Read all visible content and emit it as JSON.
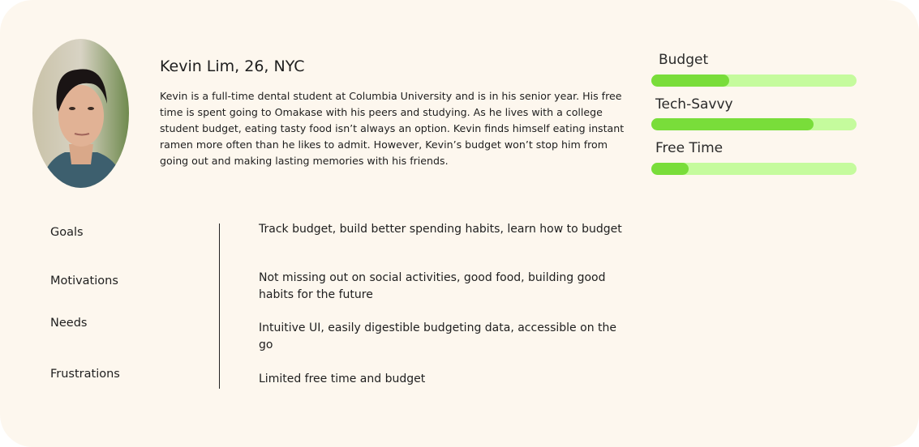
{
  "persona": {
    "name": "Kevin Lim, 26, NYC",
    "bio": "Kevin is a full-time dental student at Columbia University and is in his senior year. His free time is spent going to Omakase with his peers and studying. As he lives with a college student budget, eating tasty food isn’t always an option. Kevin finds himself eating instant ramen more often than he likes to admit. However, Kevin’s budget won’t stop him from going out and making lasting memories with his friends."
  },
  "meters": [
    {
      "label": "Budget",
      "value": 0.38
    },
    {
      "label": "Tech-Savvy",
      "value": 0.79
    },
    {
      "label": "Free Time",
      "value": 0.18
    }
  ],
  "colors": {
    "track": "#c5fb9d",
    "fill": "#79dd3a",
    "background": "#fdf7ee"
  },
  "sections": [
    {
      "label": "Goals",
      "text": "Track budget, build better spending habits, learn how to budget"
    },
    {
      "label": "Motivations",
      "text": "Not missing out on social activities, good food, building good habits for the future"
    },
    {
      "label": "Needs",
      "text": "Intuitive UI, easily digestible budgeting data, accessible on the go"
    },
    {
      "label": "Frustrations",
      "text": "Limited free time and budget"
    }
  ]
}
